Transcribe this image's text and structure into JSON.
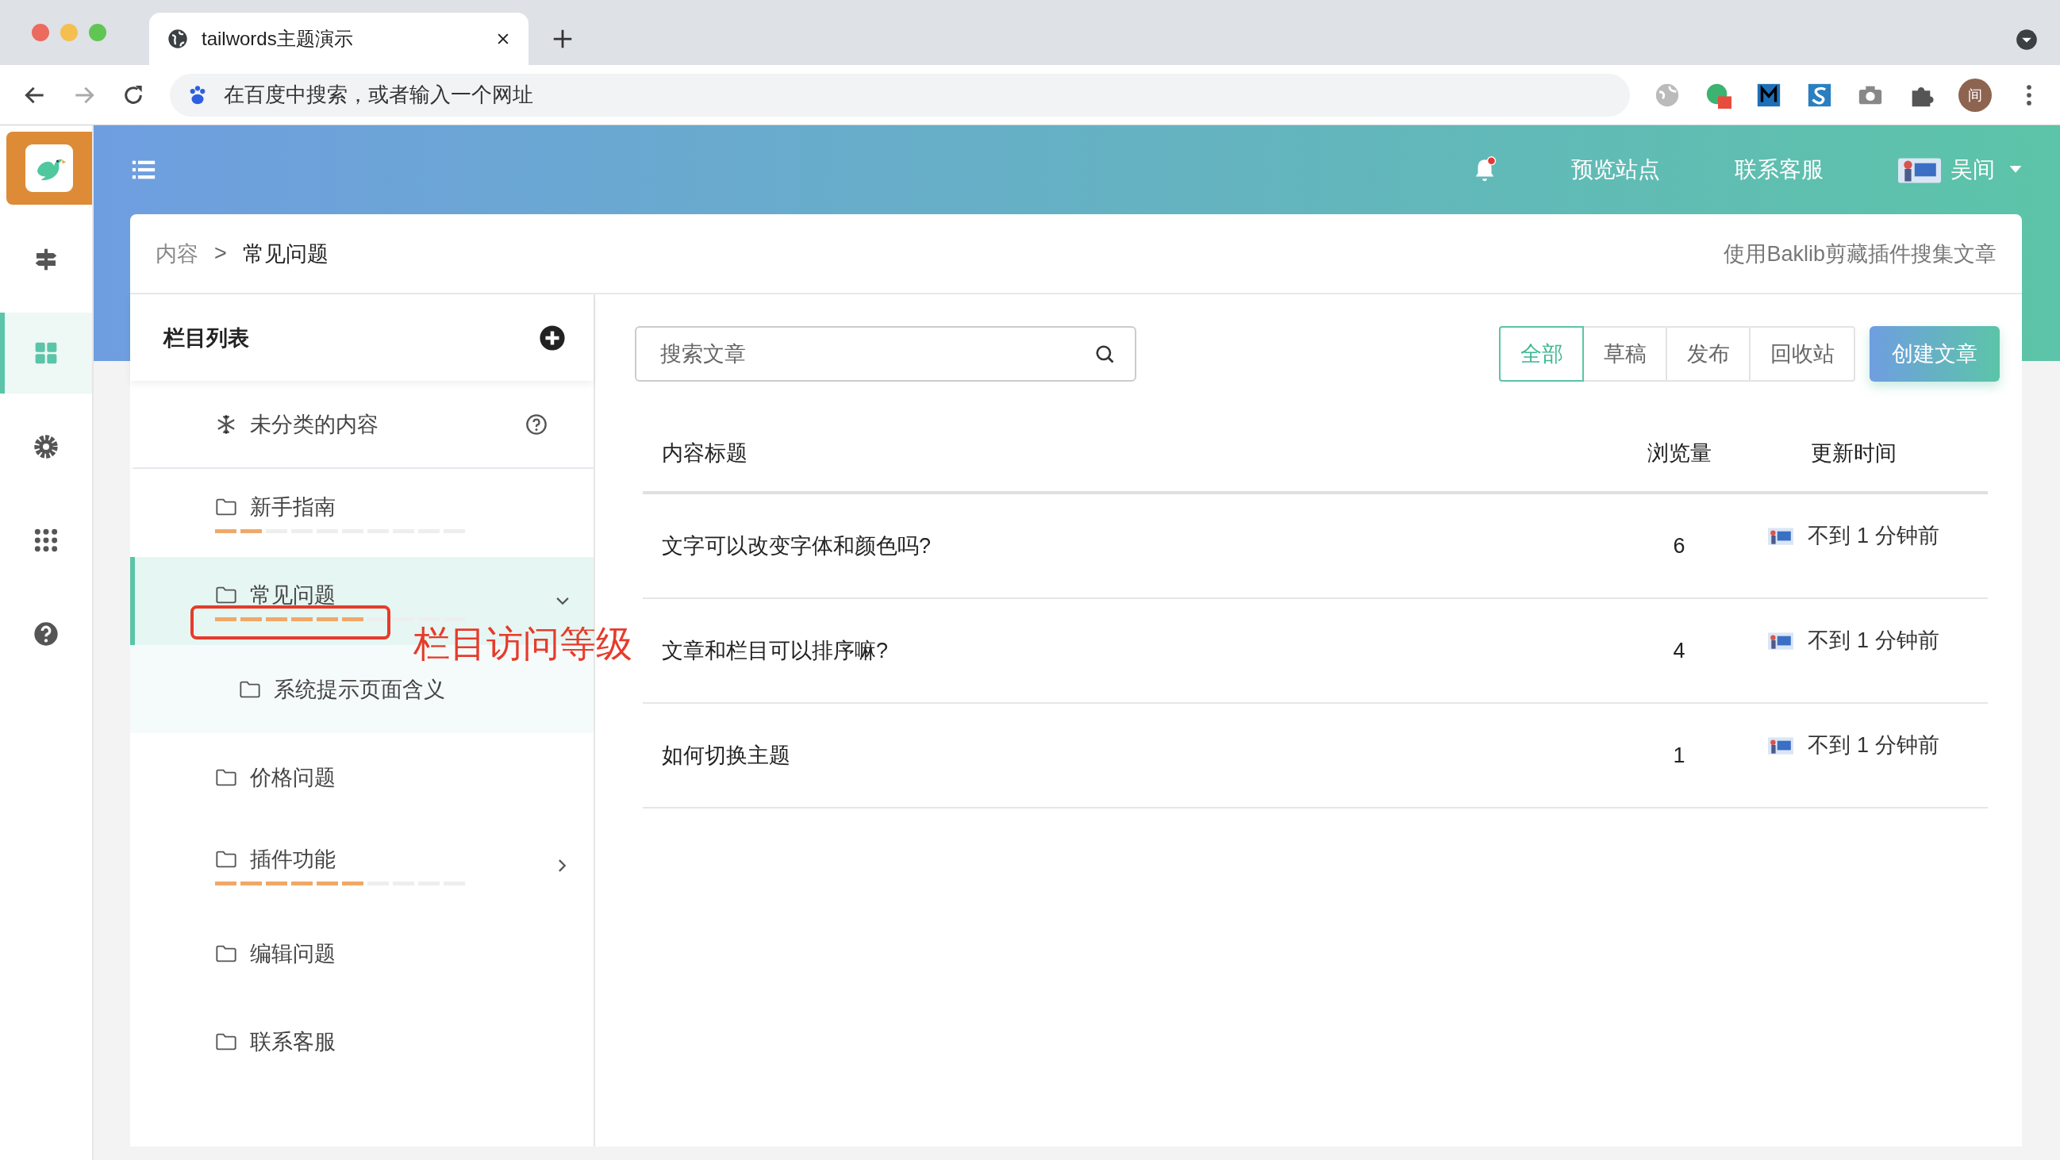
{
  "browser": {
    "tab_title": "tailwords主题演示",
    "address_placeholder": "在百度中搜索，或者输入一个网址",
    "profile_initial": "间"
  },
  "rail": [
    {
      "kind": "signpost",
      "selected": false
    },
    {
      "kind": "grid",
      "selected": true
    },
    {
      "kind": "gear",
      "selected": false
    },
    {
      "kind": "apps",
      "selected": false
    },
    {
      "kind": "help",
      "selected": false
    }
  ],
  "header": {
    "has_notification": true,
    "links": [
      "预览站点",
      "联系客服"
    ],
    "user": "吴间"
  },
  "breadcrumb": {
    "items": [
      "内容",
      "常见问题"
    ],
    "separator": ">",
    "action": "使用Baklib剪藏插件搜集文章"
  },
  "tree": {
    "title": "栏目列表",
    "items": [
      {
        "kind": "uncategorized",
        "label": "未分类的内容",
        "selected": false
      },
      {
        "kind": "folder",
        "label": "新手指南",
        "level": 0.2,
        "selected": false
      },
      {
        "kind": "folder",
        "label": "常见问题",
        "level": 0.6,
        "selected": true,
        "expanded": true,
        "children": [
          {
            "kind": "folder",
            "label": "系统提示页面含义",
            "selected": false
          }
        ]
      },
      {
        "kind": "folder",
        "label": "价格问题",
        "selected": false
      },
      {
        "kind": "folder",
        "label": "插件功能",
        "level": 0.6,
        "selected": false,
        "expanded": false
      },
      {
        "kind": "folder",
        "label": "编辑问题",
        "selected": false
      },
      {
        "kind": "folder",
        "label": "联系客服",
        "selected": false
      }
    ]
  },
  "annotation": {
    "text": "栏目访问等级"
  },
  "search": {
    "placeholder": "搜索文章"
  },
  "filters": [
    {
      "label": "全部",
      "selected": true
    },
    {
      "label": "草稿",
      "selected": false
    },
    {
      "label": "发布",
      "selected": false
    },
    {
      "label": "回收站",
      "selected": false
    }
  ],
  "create_button": "创建文章",
  "table": {
    "columns": [
      "内容标题",
      "浏览量",
      "更新时间"
    ],
    "rows": [
      {
        "title": "文字可以改变字体和颜色吗?",
        "views": "6",
        "updated": "不到 1 分钟前"
      },
      {
        "title": "文章和栏目可以排序嘛?",
        "views": "4",
        "updated": "不到 1 分钟前"
      },
      {
        "title": "如何切换主题",
        "views": "1",
        "updated": "不到 1 分钟前"
      }
    ]
  }
}
